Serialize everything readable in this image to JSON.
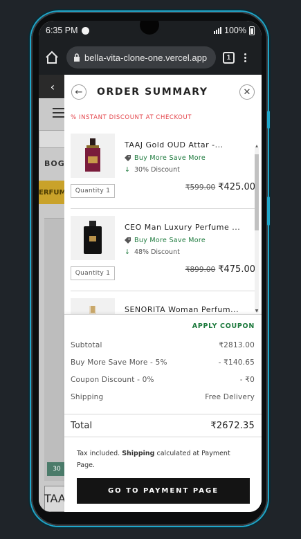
{
  "status": {
    "time": "6:35 PM",
    "battery": "100%"
  },
  "browser": {
    "url": "bella-vita-clone-one.vercel.app",
    "tabs_count": "1"
  },
  "background": {
    "brand_fragment": "BOG",
    "banner_fragment": "ERFUME",
    "badge_fragment": "30",
    "product_fragment": "TAAJ"
  },
  "drawer": {
    "title": "ORDER SUMMARY",
    "instant_discount": "% INSTANT DISCOUNT AT CHECKOUT",
    "items": [
      {
        "name": "TAAJ Gold OUD Attar -...",
        "offer": "Buy More Save More",
        "discount": "30% Discount",
        "quantity": "Quantity 1",
        "old_price": "₹599.00",
        "price": "₹425.00",
        "image_color": "#7a1c3b"
      },
      {
        "name": "CEO Man Luxury Perfume ...",
        "offer": "Buy More Save More",
        "discount": "48% Discount",
        "quantity": "Quantity 1",
        "old_price": "₹899.00",
        "price": "₹475.00",
        "image_color": "#111111"
      },
      {
        "name": "SENORITA Woman Perfum...",
        "offer": "",
        "discount": "",
        "quantity": "",
        "old_price": "",
        "price": "",
        "image_color": "#e8dcc8"
      }
    ],
    "apply_coupon": "APPLY COUPON",
    "summary": [
      {
        "label": "Subtotal",
        "value": "₹2813.00"
      },
      {
        "label": "Buy More Save More - 5%",
        "value": "- ₹140.65"
      },
      {
        "label": "Coupon Discount - 0%",
        "value": "- ₹0"
      },
      {
        "label": "Shipping",
        "value": "Free Delivery"
      }
    ],
    "total": {
      "label": "Total",
      "value": "₹2672.35"
    },
    "tax_note": {
      "pre": "Tax included. ",
      "bold": "Shipping",
      "post": " calculated at Payment Page."
    },
    "cta": "GO TO PAYMENT PAGE"
  },
  "colors": {
    "accent_green": "#1d7a3d",
    "discount_red": "#e34248",
    "cta_bg": "#141414",
    "phone_trim": "#1fa6c9"
  },
  "icons": [
    "home-icon",
    "lock-icon",
    "tabs-icon",
    "more-icon",
    "back-arrow-icon",
    "close-icon",
    "tag-icon",
    "down-arrow-icon"
  ]
}
